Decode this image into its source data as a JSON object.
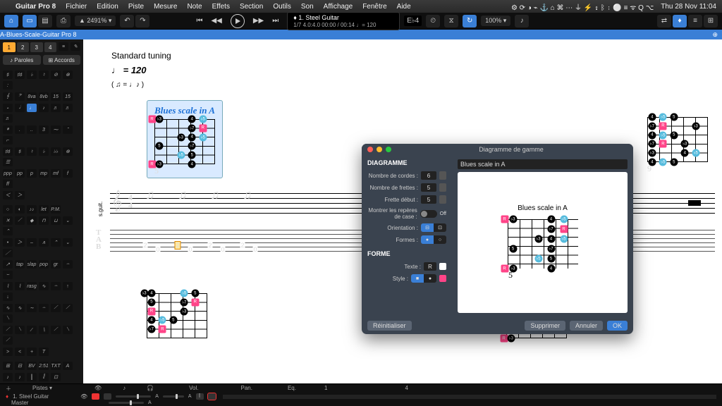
{
  "menubar": {
    "app": "Guitar Pro 8",
    "items": [
      "Fichier",
      "Edition",
      "Piste",
      "Mesure",
      "Note",
      "Effets",
      "Section",
      "Outils",
      "Son",
      "Affichage",
      "Fenêtre",
      "Aide"
    ],
    "clock": "Thu 28 Nov  11:04"
  },
  "toolbar": {
    "zoom": "▲ 2491% ▾",
    "song_title": "1. Steel Guitar",
    "song_meta": "1/7        4.0:4.0     00:00 / 00:14     ♩= 120",
    "loopbar_pct": "100% ▾",
    "time_sig": "E♭4"
  },
  "document_tab": "A-Blues-Scale-Guitar Pro 8",
  "left": {
    "nums": [
      "1",
      "2",
      "3",
      "4"
    ],
    "btn_paroles": "♪ Paroles",
    "btn_accords": "⊞ Accords"
  },
  "score": {
    "tuning": "Standard tuning",
    "tempo": "♩ = 120",
    "swing": "( ♫ = ♩♪ )",
    "scale_title": "Blues scale in A",
    "start_fret": "5",
    "start_fret2": "9",
    "track_label": "s.guit.",
    "timesig": "4\n4",
    "tab_notes": [
      "2",
      "0",
      "2",
      "0",
      "2",
      "0",
      "2",
      "0"
    ]
  },
  "dialog": {
    "title": "Diagramme de gamme",
    "sec1": "DIAGRAMME",
    "l_cordes": "Nombre de cordes :",
    "v_cordes": "6",
    "l_frettes": "Nombre de frettes :",
    "v_frettes": "5",
    "l_debut": "Frette début :",
    "v_debut": "5",
    "l_reperes": "Montrer les repères de case :",
    "v_reperes": "Off",
    "l_orient": "Orientation :",
    "l_formes": "Formes :",
    "sec2": "FORME",
    "l_texte": "Texte :",
    "v_texte": "R",
    "l_style": "Style :",
    "name_field": "Blues scale in A",
    "preview_title": "Blues scale in A",
    "preview_fret": "5",
    "btn_reset": "Réinitialiser",
    "btn_delete": "Supprimer",
    "btn_cancel": "Annuler",
    "btn_ok": "OK"
  },
  "mixer": {
    "hdr_pistes": "Pistes ▾",
    "hdr_vol": "Vol.",
    "hdr_pan": "Pan.",
    "hdr_eq": "Eq.",
    "hdr_1": "1",
    "hdr_4": "4",
    "track1": "1. Steel Guitar",
    "track2": "Master"
  }
}
